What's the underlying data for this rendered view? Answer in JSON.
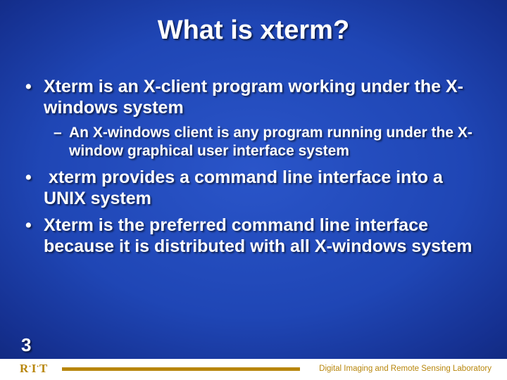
{
  "title": "What is xterm?",
  "bullets": {
    "b1": "Xterm is an X-client program working under the X-windows system",
    "b1a": "An X-windows client is any program running under the X-window graphical user interface system",
    "b2": "xterm provides a command line interface into a UNIX system",
    "b3": "Xterm is the preferred command line interface because it is distributed with all X-windows system"
  },
  "slide_number": "3",
  "footer": {
    "logo_letters": {
      "r": "R",
      "i": "I",
      "t": "T"
    },
    "lab": "Digital Imaging and Remote Sensing Laboratory"
  }
}
